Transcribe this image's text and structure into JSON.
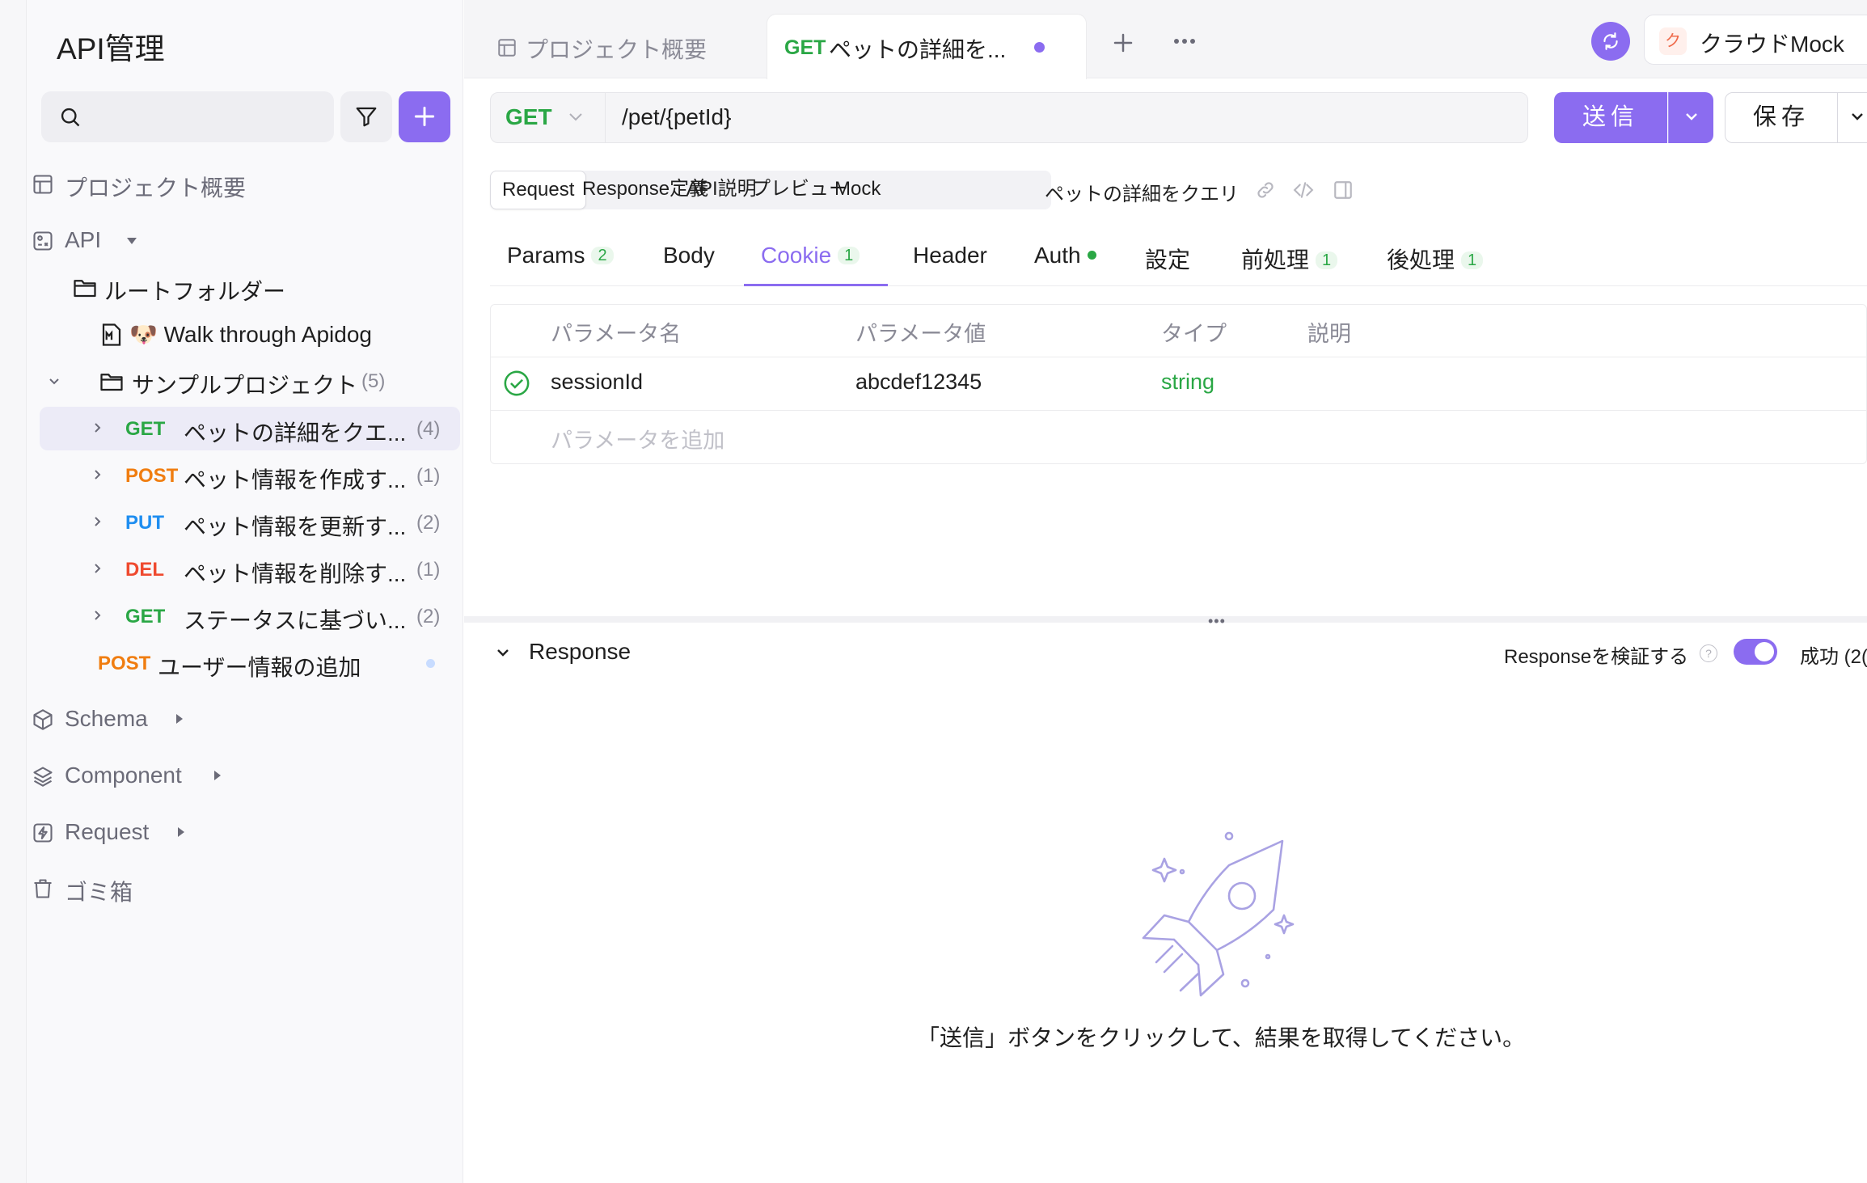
{
  "sidebar": {
    "title": "API管理",
    "search": {
      "placeholder": ""
    },
    "nav": {
      "overview": "プロジェクト概要",
      "api": "API",
      "schema": "Schema",
      "component": "Component",
      "request": "Request",
      "trash": "ゴミ箱"
    },
    "tree": {
      "root_folder": "ルートフォルダー",
      "walkthrough": "🐶 Walk through Apidog",
      "sample_project": "サンプルプロジェクト",
      "sample_count": "(5)",
      "items": [
        {
          "method": "GET",
          "label": "ペットの詳細をクエ...",
          "count": "(4)"
        },
        {
          "method": "POST",
          "label": "ペット情報を作成す...",
          "count": "(1)"
        },
        {
          "method": "PUT",
          "label": "ペット情報を更新す...",
          "count": "(2)"
        },
        {
          "method": "DEL",
          "label": "ペット情報を削除す...",
          "count": "(1)"
        },
        {
          "method": "GET",
          "label": "ステータスに基づい...",
          "count": "(2)"
        }
      ],
      "extra_item": {
        "method": "POST",
        "label": "ユーザー情報の追加"
      }
    }
  },
  "tabs": {
    "overview": "プロジェクト概要",
    "active": {
      "method": "GET",
      "label": "ペットの詳細を..."
    },
    "env_badge": "ク",
    "env": "クラウドMock"
  },
  "request": {
    "method": "GET",
    "path": "/pet/{petId}",
    "send": "送信",
    "save": "保存"
  },
  "subtabs": {
    "items": [
      "Request",
      "Response定義",
      "API説明",
      "プレビュー",
      "Mock"
    ],
    "title": "ペットの詳細をクエリ"
  },
  "param_tabs": {
    "params": "Params",
    "params_count": "2",
    "body": "Body",
    "cookie": "Cookie",
    "cookie_count": "1",
    "header": "Header",
    "auth": "Auth",
    "settings": "設定",
    "pre": "前処理",
    "pre_count": "1",
    "post": "後処理",
    "post_count": "1"
  },
  "table": {
    "headers": [
      "パラメータ名",
      "パラメータ値",
      "タイプ",
      "説明"
    ],
    "rows": [
      {
        "name": "sessionId",
        "value": "abcdef12345",
        "type": "string",
        "description": ""
      }
    ],
    "add_placeholder": "パラメータを追加"
  },
  "response": {
    "title": "Response",
    "verify_label": "Responseを検証する",
    "status": "成功 (2(",
    "empty_message": "「送信」ボタンをクリックして、結果を取得してください。"
  },
  "colors": {
    "accent": "#8b6cf0",
    "get": "#2aa745",
    "post": "#f07d10",
    "put": "#1f8ef0",
    "delete": "#ef4a2f"
  }
}
